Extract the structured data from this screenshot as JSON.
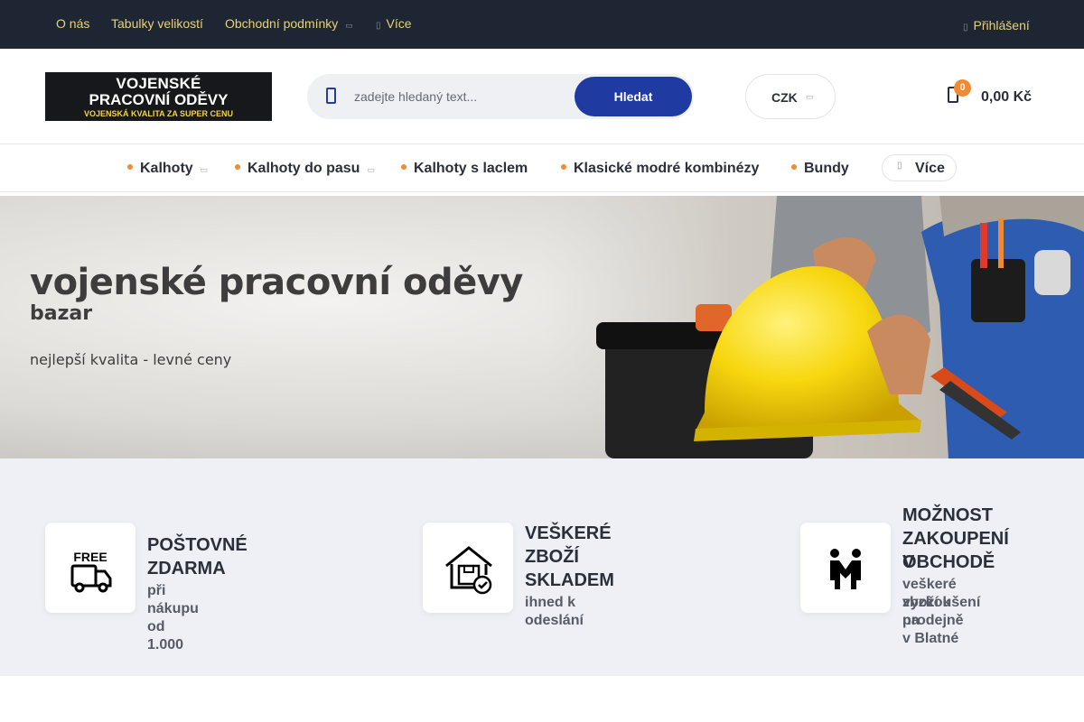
{
  "topbar": {
    "links": [
      "O nás",
      "Tabulky velikostí",
      "Obchodní podmínky"
    ],
    "more_label": "Více",
    "login_label": "Přihlášení"
  },
  "header": {
    "logo": {
      "line1": "VOJENSKÉ",
      "line2": "PRACOVNÍ ODĚVY",
      "tagline": "VOJENSKÁ KVALITA ZA SUPER CENU"
    },
    "search": {
      "placeholder": "zadejte hledaný text...",
      "button_label": "Hledat"
    },
    "currency": "CZK",
    "cart": {
      "count": "0",
      "total": "0,00 Kč"
    }
  },
  "category_nav": {
    "items": [
      "Kalhoty",
      "Kalhoty do pasu",
      "Kalhoty s laclem",
      "Klasické modré kombinézy",
      "Bundy"
    ],
    "more_label": "Více"
  },
  "banner": {
    "title": "vojenské pracovní oděvy",
    "subtitle": "bazar",
    "tagline": "nejlepší kvalita - levné ceny"
  },
  "features": [
    {
      "title_lines": [
        "POŠTOVNÉ",
        "ZDARMA"
      ],
      "sub_lines": [
        "při nákupu od 1.000"
      ],
      "icon": "free-delivery-truck-icon",
      "icon_text": "FREE"
    },
    {
      "title_lines": [
        "VEŠKERÉ",
        "ZBOŽÍ",
        "SKLADEM"
      ],
      "sub_lines": [
        "ihned k odeslání"
      ],
      "icon": "warehouse-box-check-icon"
    },
    {
      "title_lines": [
        "MOŽNOST",
        "ZAKOUPENÍ V",
        "OBCHODĚ"
      ],
      "sub_lines": [
        "veškeré zboží k",
        "vyzkoušení na",
        "prodejně v Blatné"
      ],
      "icon": "handshake-people-icon"
    }
  ],
  "colors": {
    "topbar_bg": "#1e2633",
    "topbar_link": "#e5d27a",
    "accent_blue": "#1f3aa0",
    "accent_orange": "#f08b33",
    "features_bg": "#eef0f5"
  }
}
